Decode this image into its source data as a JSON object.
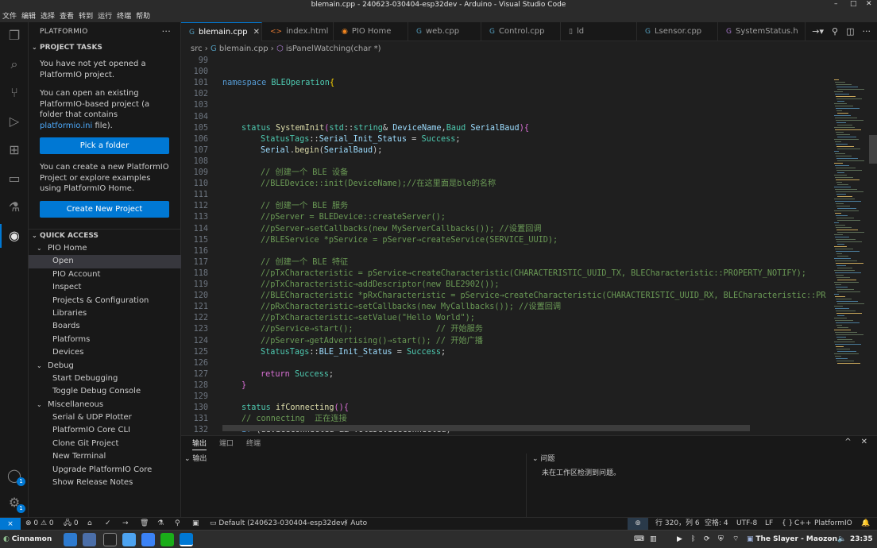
{
  "titlebar": {
    "title": "blemain.cpp - 240623-030404-esp32dev - Arduino - Visual Studio Code",
    "min": "–",
    "max": "□",
    "close": "✕"
  },
  "menu": [
    "文件",
    "编辑",
    "选择",
    "查看",
    "转到",
    "运行",
    "终端",
    "帮助"
  ],
  "activity": {
    "badge1": "1",
    "badge2": "1"
  },
  "sidebar": {
    "title": "PLATFORMIO",
    "more": "···",
    "project_tasks": "PROJECT TASKS",
    "p1": "You have not yet opened a PlatformIO project.",
    "p2_a": "You can open an existing PlatformIO-based project (a folder that contains ",
    "p2_link": "platformio.ini",
    "p2_b": " file).",
    "pick_folder": "Pick a folder",
    "p3": "You can create a new PlatformIO Project or explore examples using PlatformIO Home.",
    "create_project": "Create New Project",
    "quick_access": "QUICK ACCESS",
    "tree": [
      {
        "label": "PIO Home",
        "level": 1,
        "chev": "⌄"
      },
      {
        "label": "Open",
        "level": 2,
        "selected": true
      },
      {
        "label": "PIO Account",
        "level": 2
      },
      {
        "label": "Inspect",
        "level": 2
      },
      {
        "label": "Projects & Configuration",
        "level": 2
      },
      {
        "label": "Libraries",
        "level": 2
      },
      {
        "label": "Boards",
        "level": 2
      },
      {
        "label": "Platforms",
        "level": 2
      },
      {
        "label": "Devices",
        "level": 2
      },
      {
        "label": "Debug",
        "level": 1,
        "chev": "⌄"
      },
      {
        "label": "Start Debugging",
        "level": 2
      },
      {
        "label": "Toggle Debug Console",
        "level": 2
      },
      {
        "label": "Miscellaneous",
        "level": 1,
        "chev": "⌄"
      },
      {
        "label": "Serial & UDP Plotter",
        "level": 2
      },
      {
        "label": "PlatformIO Core CLI",
        "level": 2
      },
      {
        "label": "Clone Git Project",
        "level": 2
      },
      {
        "label": "New Terminal",
        "level": 2
      },
      {
        "label": "Upgrade PlatformIO Core",
        "level": 2
      },
      {
        "label": "Show Release Notes",
        "level": 2
      }
    ]
  },
  "tabs": [
    {
      "label": "blemain.cpp",
      "icon": "G",
      "icon_color": "#519aba",
      "active": true,
      "close": "✕"
    },
    {
      "label": "index.html",
      "icon": "<>",
      "icon_color": "#e37933"
    },
    {
      "label": "PIO Home",
      "icon": "◉",
      "icon_color": "#f5871f"
    },
    {
      "label": "web.cpp",
      "icon": "G",
      "icon_color": "#519aba"
    },
    {
      "label": "Control.cpp",
      "icon": "G",
      "icon_color": "#519aba"
    },
    {
      "label": "ld",
      "icon": "▯",
      "icon_color": "#9d9d9d"
    },
    {
      "label": "Lsensor.cpp",
      "icon": "G",
      "icon_color": "#519aba"
    },
    {
      "label": "SystemStatus.h",
      "icon": "G",
      "icon_color": "#a074c4"
    }
  ],
  "tab_actions": {
    "arrow": "→▾",
    "pin": "⚲",
    "split": "◫",
    "more": "···"
  },
  "breadcrumb": {
    "folder": "src",
    "sep": "›",
    "file": "blemain.cpp",
    "symbol": "isPanelWatching(char *)"
  },
  "code": [
    {
      "n": "99",
      "indent": 0,
      "segs": []
    },
    {
      "n": "100",
      "indent": 0,
      "segs": []
    },
    {
      "n": "101",
      "indent": 0,
      "segs": [
        [
          "kw",
          "namespace "
        ],
        [
          "ty",
          "BLEOperation"
        ],
        [
          "br",
          "{"
        ]
      ]
    },
    {
      "n": "102",
      "indent": 0,
      "segs": []
    },
    {
      "n": "103",
      "indent": 0,
      "segs": []
    },
    {
      "n": "104",
      "indent": 0,
      "segs": []
    },
    {
      "n": "105",
      "indent": 1,
      "segs": [
        [
          "ty",
          "status "
        ],
        [
          "fn",
          "SystemInit"
        ],
        [
          "br2",
          "("
        ],
        [
          "ty",
          "std"
        ],
        [
          "",
          "::"
        ],
        [
          "ty",
          "string"
        ],
        [
          "",
          "& "
        ],
        [
          "vr",
          "DeviceName"
        ],
        [
          "",
          ","
        ],
        [
          "ty",
          "Baud "
        ],
        [
          "vr",
          "SerialBaud"
        ],
        [
          "br2",
          ")"
        ],
        [
          "br2",
          "{"
        ]
      ]
    },
    {
      "n": "106",
      "indent": 2,
      "segs": [
        [
          "ty",
          "StatusTags"
        ],
        [
          "",
          "::"
        ],
        [
          "vr",
          "Serial_Init_Status"
        ],
        [
          "",
          " = "
        ],
        [
          "ty",
          "Success"
        ],
        [
          "",
          ";"
        ]
      ]
    },
    {
      "n": "107",
      "indent": 2,
      "segs": [
        [
          "vr",
          "Serial"
        ],
        [
          "",
          "."
        ],
        [
          "fn",
          "begin"
        ],
        [
          "",
          "("
        ],
        [
          "vr",
          "SerialBaud"
        ],
        [
          "",
          ");"
        ]
      ]
    },
    {
      "n": "108",
      "indent": 0,
      "segs": []
    },
    {
      "n": "109",
      "indent": 2,
      "segs": [
        [
          "cm",
          "// 创建一个 BLE 设备"
        ]
      ]
    },
    {
      "n": "110",
      "indent": 2,
      "segs": [
        [
          "cm",
          "//BLEDevice::init(DeviceName);//在这里面是ble的名称"
        ]
      ]
    },
    {
      "n": "111",
      "indent": 0,
      "segs": []
    },
    {
      "n": "112",
      "indent": 2,
      "segs": [
        [
          "cm",
          "// 创建一个 BLE 服务"
        ]
      ]
    },
    {
      "n": "113",
      "indent": 2,
      "segs": [
        [
          "cm",
          "//pServer = BLEDevice::createServer();"
        ]
      ]
    },
    {
      "n": "114",
      "indent": 2,
      "segs": [
        [
          "cm",
          "//pServer→setCallbacks(new MyServerCallbacks()); //设置回调"
        ]
      ]
    },
    {
      "n": "115",
      "indent": 2,
      "segs": [
        [
          "cm",
          "//BLEService *pService = pServer→createService(SERVICE_UUID);"
        ]
      ]
    },
    {
      "n": "116",
      "indent": 0,
      "segs": []
    },
    {
      "n": "117",
      "indent": 2,
      "segs": [
        [
          "cm",
          "// 创建一个 BLE 特征"
        ]
      ]
    },
    {
      "n": "118",
      "indent": 2,
      "segs": [
        [
          "cm",
          "//pTxCharacteristic = pService→createCharacteristic(CHARACTERISTIC_UUID_TX, BLECharacteristic::PROPERTY_NOTIFY);"
        ]
      ]
    },
    {
      "n": "119",
      "indent": 2,
      "segs": [
        [
          "cm",
          "//pTxCharacteristic→addDescriptor(new BLE2902());"
        ]
      ]
    },
    {
      "n": "120",
      "indent": 2,
      "segs": [
        [
          "cm",
          "//BLECharacteristic *pRxCharacteristic = pService→createCharacteristic(CHARACTERISTIC_UUID_RX, BLECharacteristic::PR"
        ]
      ]
    },
    {
      "n": "121",
      "indent": 2,
      "segs": [
        [
          "cm",
          "//pRxCharacteristic→setCallbacks(new MyCallbacks()); //设置回调"
        ]
      ]
    },
    {
      "n": "122",
      "indent": 2,
      "segs": [
        [
          "cm",
          "//pTxCharacteristic→setValue(\"Hello World\");"
        ]
      ]
    },
    {
      "n": "123",
      "indent": 2,
      "segs": [
        [
          "cm",
          "//pService→start();                 // 开始服务"
        ]
      ]
    },
    {
      "n": "124",
      "indent": 2,
      "segs": [
        [
          "cm",
          "//pServer→getAdvertising()→start(); // 开始广播"
        ]
      ]
    },
    {
      "n": "125",
      "indent": 2,
      "segs": [
        [
          "ty",
          "StatusTags"
        ],
        [
          "",
          "::"
        ],
        [
          "vr",
          "BLE_Init_Status"
        ],
        [
          "",
          " = "
        ],
        [
          "ty",
          "Success"
        ],
        [
          "",
          ";"
        ]
      ]
    },
    {
      "n": "126",
      "indent": 0,
      "segs": []
    },
    {
      "n": "127",
      "indent": 2,
      "segs": [
        [
          "br2",
          "return "
        ],
        [
          "ty",
          "Success"
        ],
        [
          "",
          ";"
        ]
      ]
    },
    {
      "n": "128",
      "indent": 1,
      "segs": [
        [
          "br2",
          "}"
        ]
      ]
    },
    {
      "n": "129",
      "indent": 0,
      "segs": []
    },
    {
      "n": "130",
      "indent": 1,
      "segs": [
        [
          "ty",
          "status "
        ],
        [
          "fn",
          "ifConnecting"
        ],
        [
          "br2",
          "()"
        ],
        [
          "br2",
          "{"
        ]
      ]
    },
    {
      "n": "131",
      "indent": 1,
      "segs": [
        [
          "cm",
          "// connecting  正在连接"
        ]
      ]
    },
    {
      "n": "132",
      "indent": 1,
      "segs": [
        [
          "kw",
          "if "
        ],
        [
          "",
          "(deviceConnected && !oldDeviceConnected)"
        ]
      ]
    }
  ],
  "panel": {
    "tabs": [
      "输出",
      "端口",
      "终端"
    ],
    "actions": {
      "max": "^",
      "close": "✕"
    },
    "left_title": "输出",
    "left_chev": "⌄",
    "right_chev": "⌄",
    "right_title": "问题",
    "problems": "未在工作区检测到问题。"
  },
  "status": {
    "remote": "⨯",
    "errors": "⊗ 0 ⚠ 0",
    "ports": "🖧 0",
    "env": "Default (240623-030404-esp32dev)",
    "auto": "Auto",
    "position": "行 320，列 6",
    "spaces": "空格: 4",
    "encoding": "UTF-8",
    "eol": "LF",
    "lang_braces": "{ }",
    "lang": "C++",
    "platform": "PlatformIO"
  },
  "taskbar": {
    "start": "Cinnamon",
    "tray_user": "The Slayer - Maozon",
    "clock": "23:35"
  }
}
